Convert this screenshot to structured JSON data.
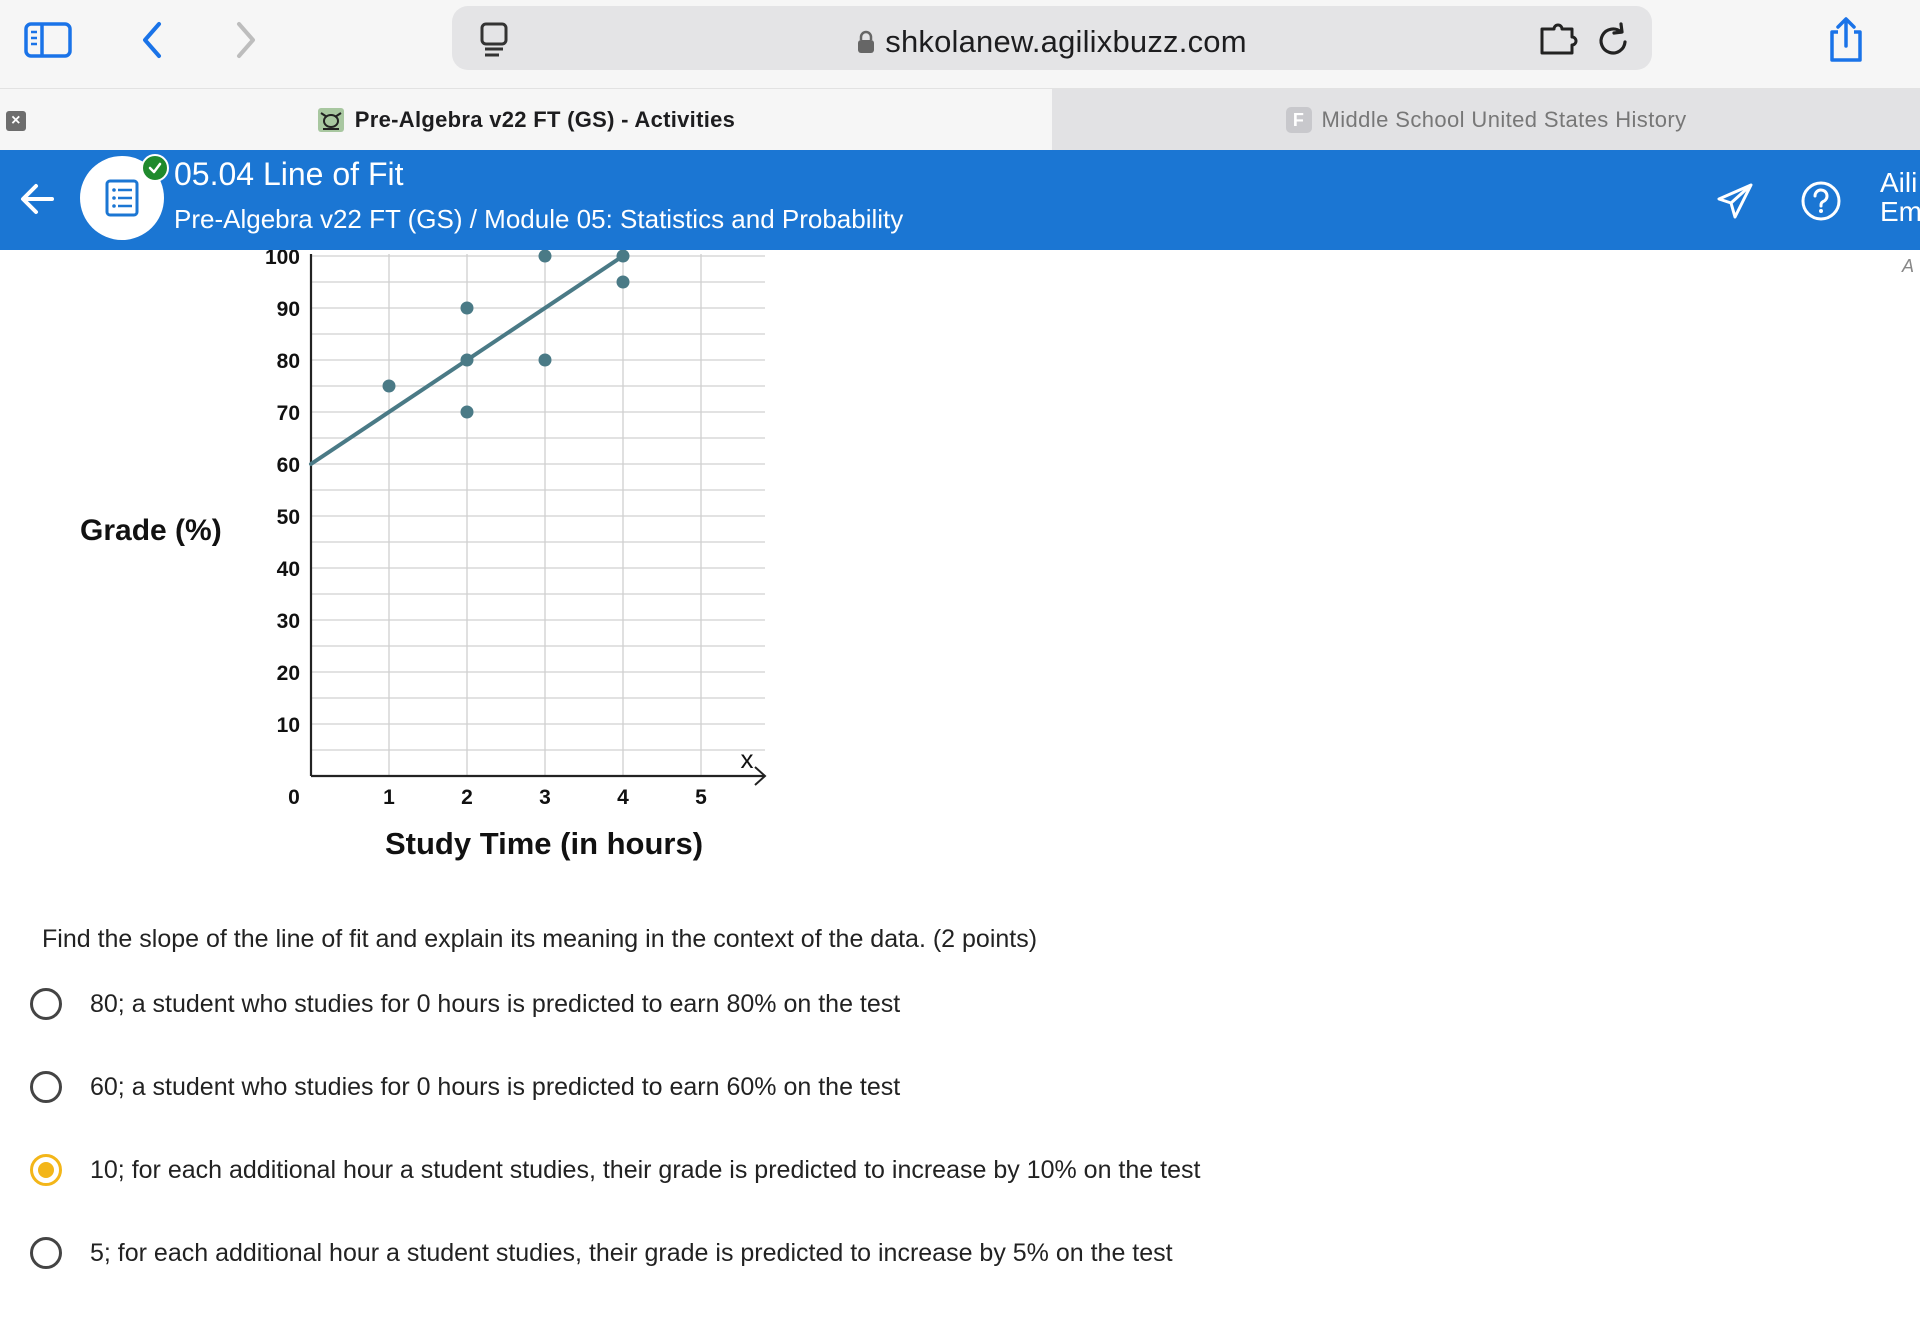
{
  "browser": {
    "url": "shkolanew.agilixbuzz.com",
    "icons": [
      "sidebar-icon",
      "back-icon",
      "forward-icon",
      "reader-icon",
      "lock-icon",
      "extension-icon",
      "reload-icon",
      "share-icon"
    ]
  },
  "tabs": {
    "active": {
      "title": "Pre-Algebra v22 FT (GS) - Activities",
      "close_glyph": "×"
    },
    "inactive": {
      "favicon_letter": "F",
      "title": "Middle School United States History"
    }
  },
  "header": {
    "title": "05.04 Line of Fit",
    "breadcrumb": "Pre-Algebra v22 FT (GS) / Module 05: Statistics and Probability",
    "user_line1": "Aili",
    "user_line2": "Em",
    "side_letter": "A",
    "colors": {
      "header_bg": "#1b76d3"
    }
  },
  "chart_data": {
    "type": "scatter",
    "xlabel": "Study Time (in hours)",
    "ylabel": "Grade (%)",
    "x_axis_letter": "x",
    "x_ticks": [
      "0",
      "1",
      "2",
      "3",
      "4",
      "5"
    ],
    "y_ticks": [
      "10",
      "20",
      "30",
      "40",
      "50",
      "60",
      "70",
      "80",
      "90",
      "100"
    ],
    "xlim": [
      0,
      5.8
    ],
    "ylim": [
      0,
      100
    ],
    "grid": true,
    "points": [
      {
        "x": 1,
        "y": 75
      },
      {
        "x": 2,
        "y": 90
      },
      {
        "x": 2,
        "y": 80
      },
      {
        "x": 2,
        "y": 70
      },
      {
        "x": 3,
        "y": 100
      },
      {
        "x": 3,
        "y": 80
      },
      {
        "x": 4,
        "y": 100
      },
      {
        "x": 4,
        "y": 95
      }
    ],
    "line_of_fit": {
      "slope": 10,
      "intercept": 60
    },
    "colors": {
      "marks": "#4a7a86",
      "grid": "#d0d0d0",
      "axis": "#222222"
    }
  },
  "question": {
    "prompt": "Find the slope of the line of fit and explain its meaning in the context of the data. (2 points)",
    "options": [
      {
        "text": "80; a student who studies for 0 hours is predicted to earn 80% on the test",
        "selected": false
      },
      {
        "text": "60; a student who studies for 0 hours is predicted to earn 60% on the test",
        "selected": false
      },
      {
        "text": "10; for each additional hour a student studies, their grade is predicted to increase by 10% on the test",
        "selected": true
      },
      {
        "text": "5; for each additional hour a student studies, their grade is predicted to increase by 5% on the test",
        "selected": false
      }
    ],
    "colors": {
      "selected": "#f3b619"
    }
  }
}
